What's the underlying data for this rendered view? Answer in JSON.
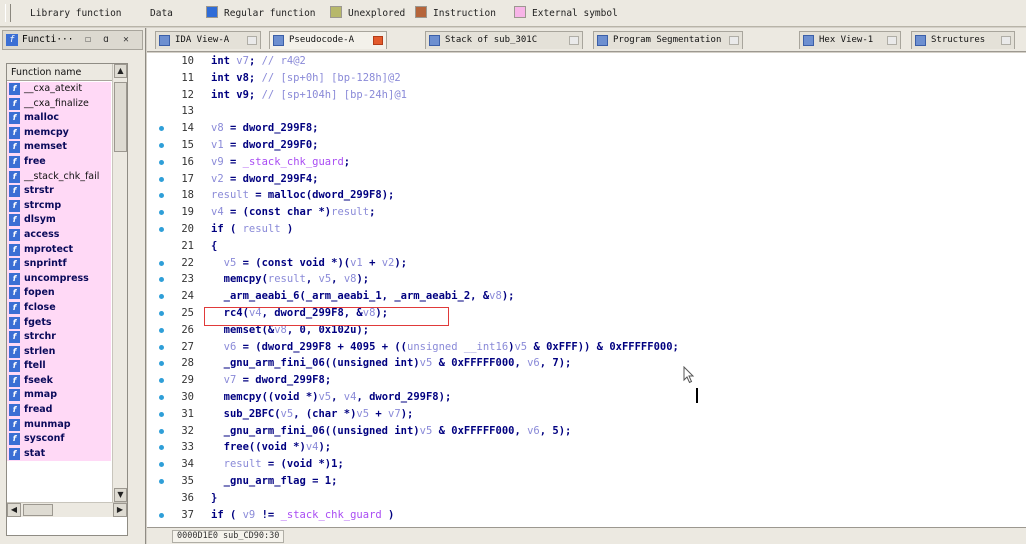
{
  "legend": {
    "items": [
      {
        "label": "Library function",
        "color": "#00000000"
      },
      {
        "label": "Data",
        "color": "#00000000"
      },
      {
        "label": "Regular function",
        "color": "#2f6cd8"
      },
      {
        "label": "Unexplored",
        "color": "#b7b86b"
      },
      {
        "label": "Instruction",
        "color": "#b5643a"
      },
      {
        "label": "External symbol",
        "color": "#f8b5e8"
      }
    ]
  },
  "functions_pane": {
    "title": "Functi···",
    "column_header": "Function name",
    "items": [
      {
        "name": "__cxa_atexit",
        "kind": "lib"
      },
      {
        "name": "__cxa_finalize",
        "kind": "lib"
      },
      {
        "name": "malloc",
        "kind": "imp"
      },
      {
        "name": "memcpy",
        "kind": "imp"
      },
      {
        "name": "memset",
        "kind": "imp"
      },
      {
        "name": "free",
        "kind": "imp"
      },
      {
        "name": "__stack_chk_fail",
        "kind": "lib"
      },
      {
        "name": "strstr",
        "kind": "imp"
      },
      {
        "name": "strcmp",
        "kind": "imp"
      },
      {
        "name": "dlsym",
        "kind": "imp"
      },
      {
        "name": "access",
        "kind": "imp"
      },
      {
        "name": "mprotect",
        "kind": "imp"
      },
      {
        "name": "snprintf",
        "kind": "imp"
      },
      {
        "name": "uncompress",
        "kind": "imp"
      },
      {
        "name": "fopen",
        "kind": "imp"
      },
      {
        "name": "fclose",
        "kind": "imp"
      },
      {
        "name": "fgets",
        "kind": "imp"
      },
      {
        "name": "strchr",
        "kind": "imp"
      },
      {
        "name": "strlen",
        "kind": "imp"
      },
      {
        "name": "ftell",
        "kind": "imp"
      },
      {
        "name": "fseek",
        "kind": "imp"
      },
      {
        "name": "mmap",
        "kind": "imp"
      },
      {
        "name": "fread",
        "kind": "imp"
      },
      {
        "name": "munmap",
        "kind": "imp"
      },
      {
        "name": "sysconf",
        "kind": "imp"
      },
      {
        "name": "stat",
        "kind": "imp"
      }
    ]
  },
  "tabs": [
    {
      "label": "IDA View-A",
      "active": false
    },
    {
      "label": "Pseudocode-A",
      "active": true
    },
    {
      "label": "Stack of sub_301C",
      "active": false
    },
    {
      "label": "Program Segmentation",
      "active": false
    },
    {
      "label": "Hex View-1",
      "active": false
    },
    {
      "label": "Structures",
      "active": false
    }
  ],
  "code": {
    "lines": [
      {
        "num": "10",
        "bp": false,
        "html": "int <span class='v'>v7</span>; <span class='c'>// r4@2</span>"
      },
      {
        "num": "11",
        "bp": false,
        "html": "int v8; <span class='c'>// [sp+0h] [bp-128h]@2</span>"
      },
      {
        "num": "12",
        "bp": false,
        "html": "int v9; <span class='c'>// [sp+104h] [bp-24h]@1</span>"
      },
      {
        "num": "13",
        "bp": false,
        "html": ""
      },
      {
        "num": "14",
        "bp": true,
        "html": "<span class='v'>v8</span> = dword_299F8;"
      },
      {
        "num": "15",
        "bp": true,
        "html": "<span class='v'>v1</span> = dword_299F0;"
      },
      {
        "num": "16",
        "bp": true,
        "html": "<span class='v'>v9</span> = <span class='g'>_stack_chk_guard</span>;"
      },
      {
        "num": "17",
        "bp": true,
        "html": "<span class='v'>v2</span> = dword_299F4;"
      },
      {
        "num": "18",
        "bp": true,
        "html": "<span class='v'>result</span> = malloc(dword_299F8);"
      },
      {
        "num": "19",
        "bp": true,
        "html": "<span class='v'>v4</span> = (const char *)<span class='v'>result</span>;"
      },
      {
        "num": "20",
        "bp": true,
        "html": "if ( <span class='v'>result</span> )"
      },
      {
        "num": "21",
        "bp": false,
        "html": "{"
      },
      {
        "num": "22",
        "bp": true,
        "html": "  <span class='v'>v5</span> = (const void *)(<span class='v'>v1</span> + <span class='v'>v2</span>);"
      },
      {
        "num": "23",
        "bp": true,
        "html": "  memcpy(<span class='v'>result</span>, <span class='v'>v5</span>, <span class='v'>v8</span>);"
      },
      {
        "num": "24",
        "bp": true,
        "html": "  _arm_aeabi_6(_arm_aeabi_1, _arm_aeabi_2, &amp;<span class='v'>v8</span>);"
      },
      {
        "num": "25",
        "bp": true,
        "html": "  rc4(<span class='v'>v4</span>, dword_299F8, &amp;<span class='v'>v8</span>);"
      },
      {
        "num": "26",
        "bp": true,
        "html": "  memset(&amp;<span class='v'>v8</span>, 0, 0x102u);"
      },
      {
        "num": "27",
        "bp": true,
        "html": "  <span class='v'>v6</span> = (dword_299F8 + 4095 + ((<span class='v'>unsigned __int16</span>)<span class='v'>v5</span> &amp; 0xFFF)) &amp; 0xFFFFF000;"
      },
      {
        "num": "28",
        "bp": true,
        "html": "  _gnu_arm_fini_06((unsigned int)<span class='v'>v5</span> &amp; 0xFFFFF000, <span class='v'>v6</span>, 7);"
      },
      {
        "num": "29",
        "bp": true,
        "html": "  <span class='v'>v7</span> = dword_299F8;"
      },
      {
        "num": "30",
        "bp": true,
        "html": "  memcpy((void *)<span class='v'>v5</span>, <span class='v'>v4</span>, dword_299F8);"
      },
      {
        "num": "31",
        "bp": true,
        "html": "  sub_2BFC(<span class='v'>v5</span>, (char *)<span class='v'>v5</span> + <span class='v'>v7</span>);"
      },
      {
        "num": "32",
        "bp": true,
        "html": "  _gnu_arm_fini_06((unsigned int)<span class='v'>v5</span> &amp; 0xFFFFF000, <span class='v'>v6</span>, 5);"
      },
      {
        "num": "33",
        "bp": true,
        "html": "  free((void *)<span class='v'>v4</span>);"
      },
      {
        "num": "34",
        "bp": true,
        "html": "  <span class='v'>result</span> = (void *)1;"
      },
      {
        "num": "35",
        "bp": true,
        "html": "  _gnu_arm_flag = 1;"
      },
      {
        "num": "36",
        "bp": false,
        "html": "}"
      },
      {
        "num": "37",
        "bp": true,
        "html": "if ( <span class='v'>v9</span> != <span class='g'>_stack_chk_guard</span> )"
      }
    ]
  },
  "status": {
    "address": "0000D1E0 sub_CD90:30"
  }
}
